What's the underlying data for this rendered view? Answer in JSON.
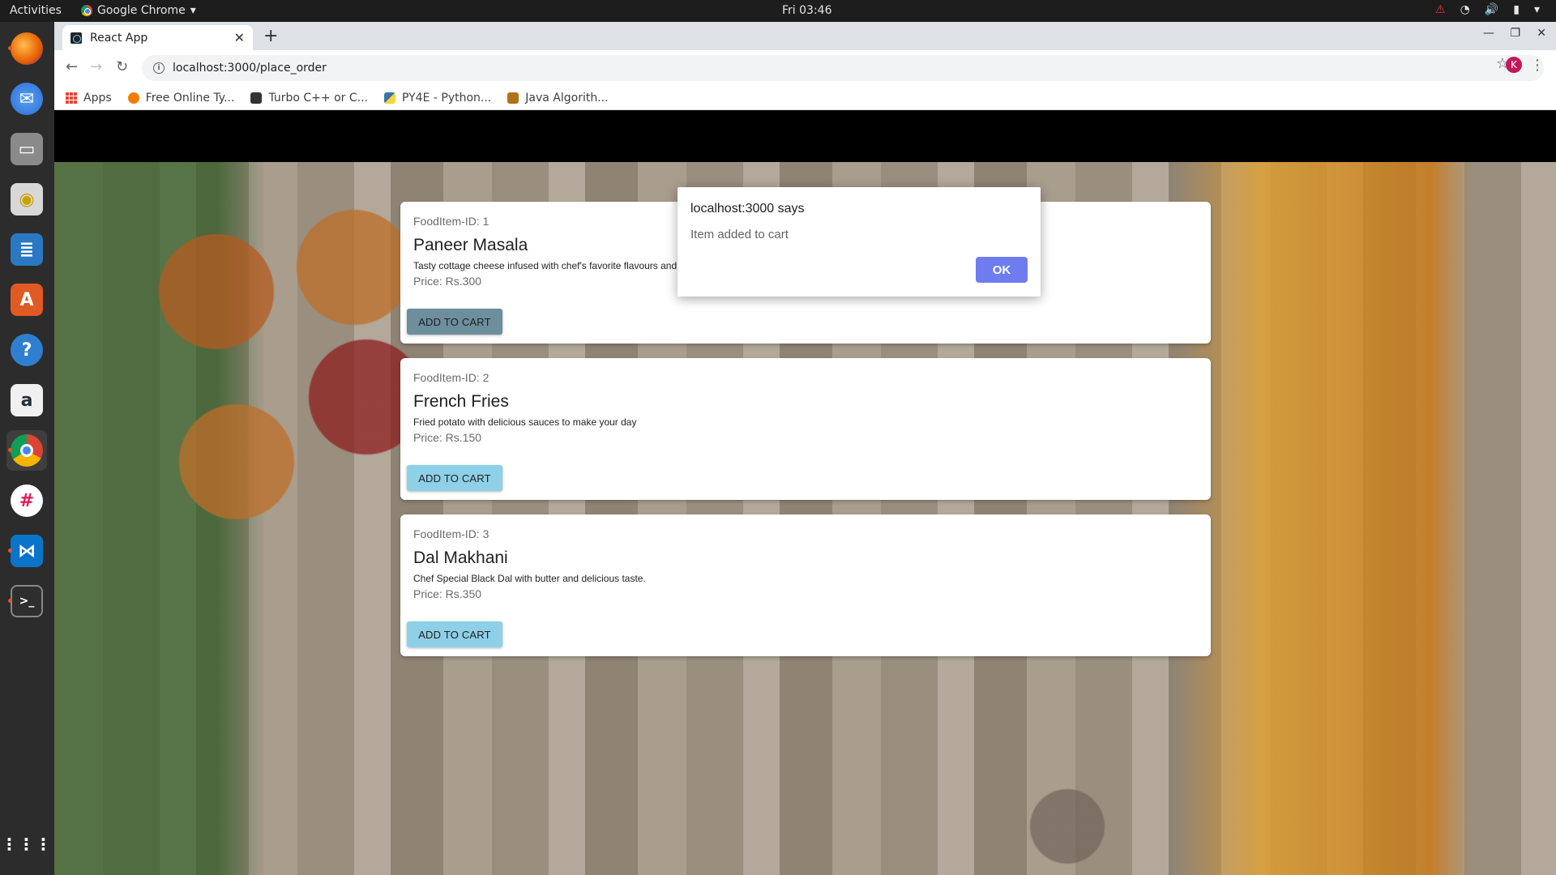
{
  "system": {
    "activities": "Activities",
    "app_name": "Google Chrome",
    "clock": "Fri 03:46"
  },
  "dock": {
    "items": [
      {
        "icon": "firefox-icon",
        "color": "#e66000"
      },
      {
        "icon": "thunderbird-icon",
        "color": "#2a6ed8"
      },
      {
        "icon": "files-icon",
        "color": "#7a7a7a"
      },
      {
        "icon": "rhythmbox-icon",
        "color": "#c8a200"
      },
      {
        "icon": "writer-icon",
        "color": "#2b78c2"
      },
      {
        "icon": "software-icon",
        "color": "#e05a23"
      },
      {
        "icon": "help-icon",
        "color": "#2f7fd0"
      },
      {
        "icon": "amazon-icon",
        "color": "#232f3e"
      },
      {
        "icon": "chrome-icon",
        "color": "#4285f4"
      },
      {
        "icon": "slack-icon",
        "color": "#ffffff"
      },
      {
        "icon": "vscode-icon",
        "color": "#0a74c9"
      },
      {
        "icon": "terminal-icon",
        "color": "#2e2e2e"
      },
      {
        "icon": "show-apps-icon",
        "color": "#2c2c2c"
      }
    ]
  },
  "browser": {
    "tab_title": "React App",
    "url": "localhost:3000/place_order",
    "avatar_letter": "K",
    "bookmarks": [
      {
        "label": "Apps",
        "icon": "apps-grid-icon"
      },
      {
        "label": "Free Online Ty...",
        "icon": "typing-icon",
        "color": "#f57c00"
      },
      {
        "label": "Turbo C++ or C...",
        "icon": "c-icon",
        "color": "#333333"
      },
      {
        "label": "PY4E - Python...",
        "icon": "python-icon",
        "color": "#3776ab"
      },
      {
        "label": "Java Algorith...",
        "icon": "java-icon",
        "color": "#b07219"
      }
    ]
  },
  "dialog": {
    "title": "localhost:3000 says",
    "message": "Item added to cart",
    "ok_label": "OK",
    "ok_color": "#6f7cf0"
  },
  "menu": {
    "items": [
      {
        "id_label": "FoodItem-ID: 1",
        "name": "Paneer Masala",
        "description": "Tasty cottage cheese infused with chef's favorite flavours and delight to your buds",
        "price": "Price: Rs.300",
        "button": "ADD TO CART"
      },
      {
        "id_label": "FoodItem-ID: 2",
        "name": "French Fries",
        "description": "Fried potato with delicious sauces to make your day",
        "price": "Price: Rs.150",
        "button": "ADD TO CART"
      },
      {
        "id_label": "FoodItem-ID: 3",
        "name": "Dal Makhani",
        "description": "Chef Special Black Dal with butter and delicious taste.",
        "price": "Price: Rs.350",
        "button": "ADD TO CART"
      }
    ]
  }
}
